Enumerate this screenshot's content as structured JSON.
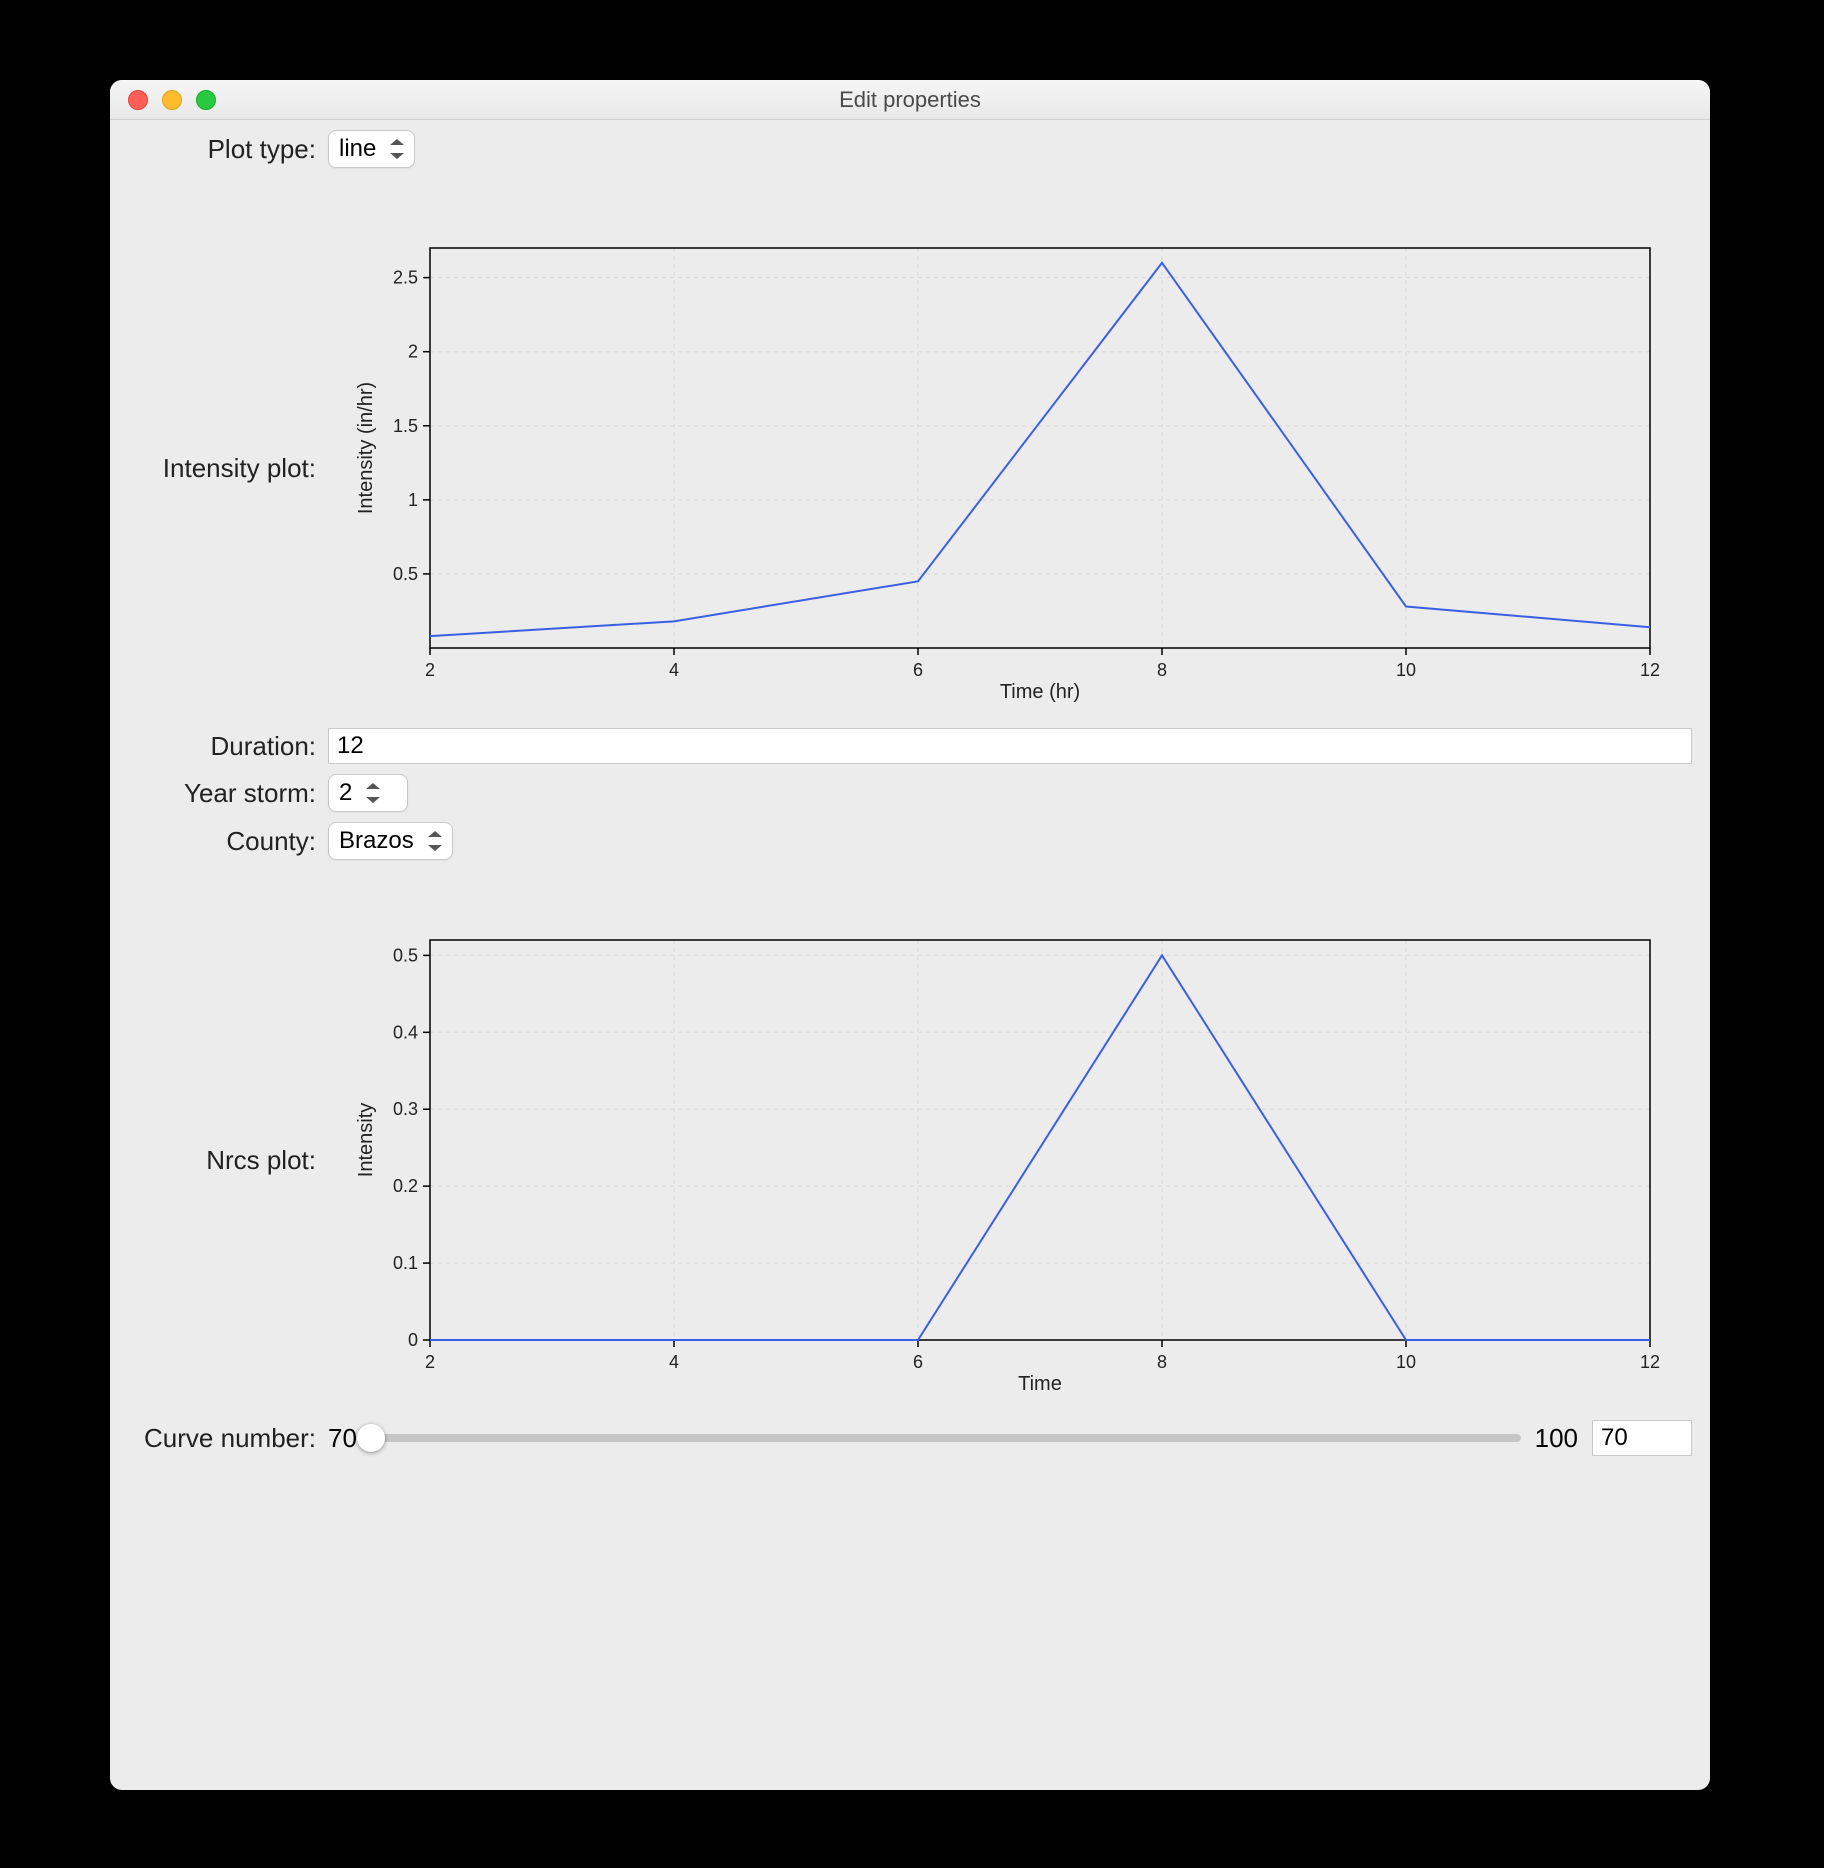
{
  "window": {
    "title": "Edit properties"
  },
  "labels": {
    "plot_type": "Plot type:",
    "intensity_plot": "Intensity plot:",
    "duration": "Duration:",
    "year_storm": "Year storm:",
    "county": "County:",
    "nrcs_plot": "Nrcs plot:",
    "curve_number": "Curve number:"
  },
  "fields": {
    "plot_type": "line",
    "duration": "12",
    "year_storm": "2",
    "county": "Brazos",
    "curve_min": "70",
    "curve_max": "100",
    "curve_value": "70"
  },
  "chart_data": [
    {
      "type": "line",
      "name": "intensity_plot",
      "x": [
        2,
        4,
        6,
        8,
        10,
        12
      ],
      "values": [
        0.08,
        0.18,
        0.45,
        2.6,
        0.28,
        0.14
      ],
      "xlim": [
        2,
        12
      ],
      "ylim": [
        0,
        2.7
      ],
      "xticks": [
        2,
        4,
        6,
        8,
        10,
        12
      ],
      "yticks": [
        0.5,
        1,
        1.5,
        2,
        2.5
      ],
      "ytick_labels": [
        "0.5",
        "1",
        "1.5",
        "2",
        "2.5"
      ],
      "xlabel": "Time (hr)",
      "ylabel": "Intensity (in/hr)"
    },
    {
      "type": "line",
      "name": "nrcs_plot",
      "x": [
        2,
        4,
        6,
        8,
        10,
        12
      ],
      "values": [
        0,
        0,
        0,
        0.5,
        0,
        0
      ],
      "xlim": [
        2,
        12
      ],
      "ylim": [
        0,
        0.52
      ],
      "xticks": [
        2,
        4,
        6,
        8,
        10,
        12
      ],
      "yticks": [
        0,
        0.1,
        0.2,
        0.3,
        0.4,
        0.5
      ],
      "ytick_labels": [
        "0",
        "0.1",
        "0.2",
        "0.3",
        "0.4",
        "0.5"
      ],
      "xlabel": "Time",
      "ylabel": "Intensity"
    }
  ]
}
